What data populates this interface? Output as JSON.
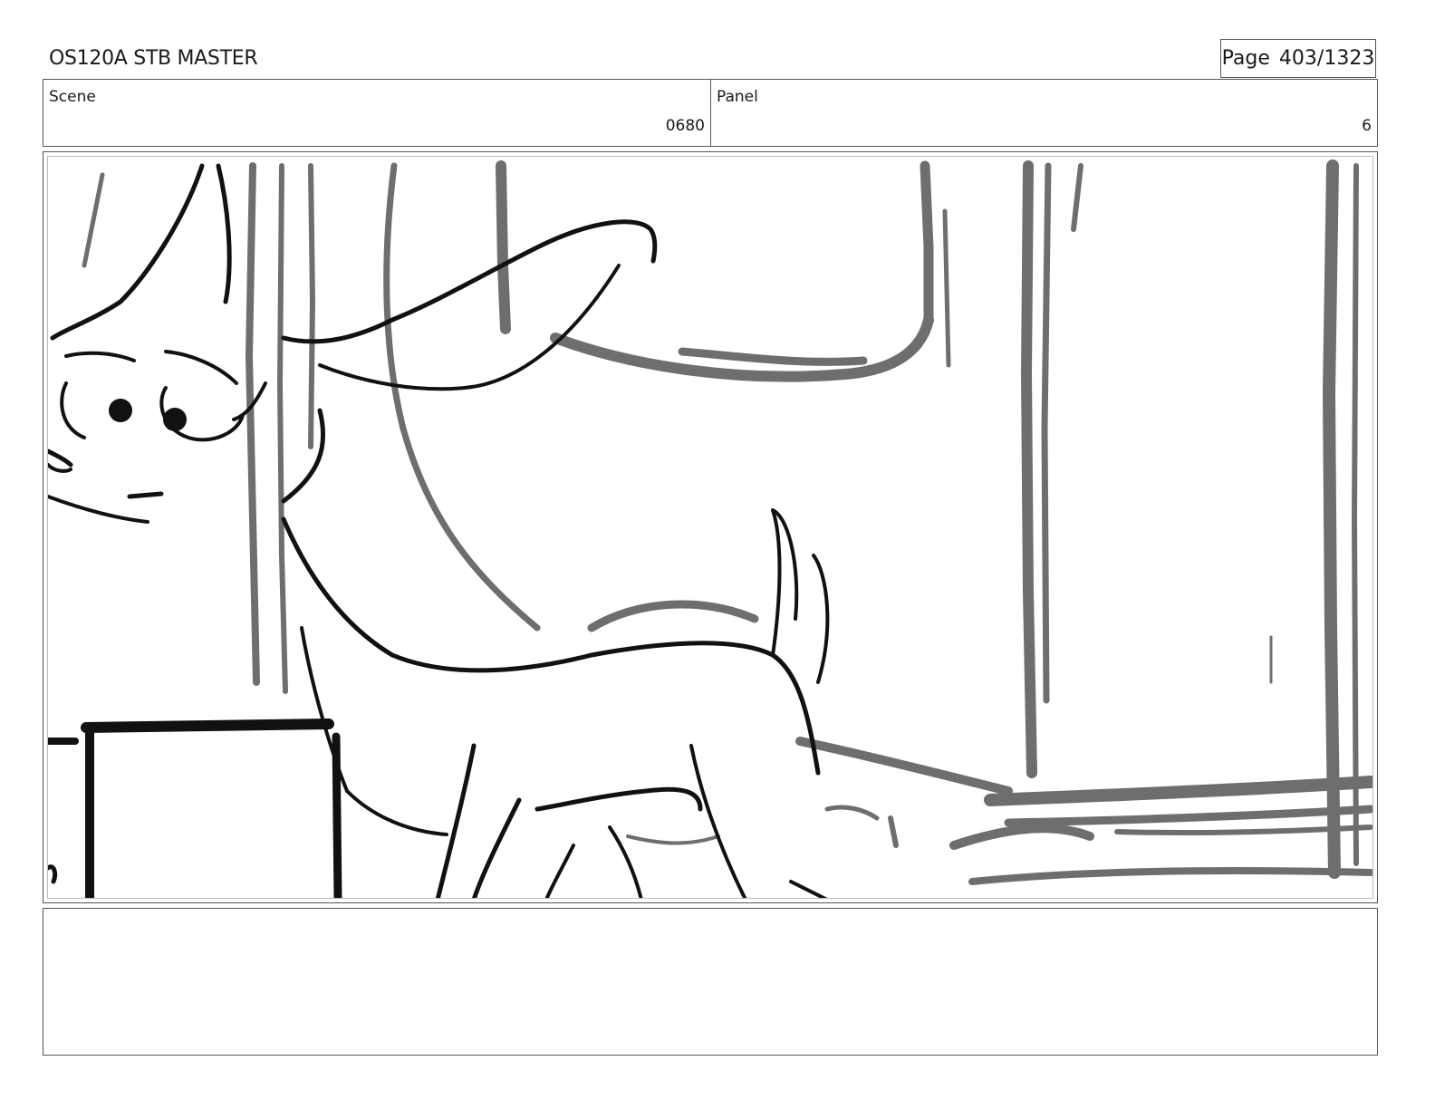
{
  "header": {
    "title": "OS120A STB MASTER",
    "page_label": "Page",
    "page_value": "403/1323"
  },
  "info": {
    "scene_label": "Scene",
    "scene_value": "0680",
    "panel_label": "Panel",
    "panel_value": "6"
  },
  "notes": {
    "text": ""
  }
}
